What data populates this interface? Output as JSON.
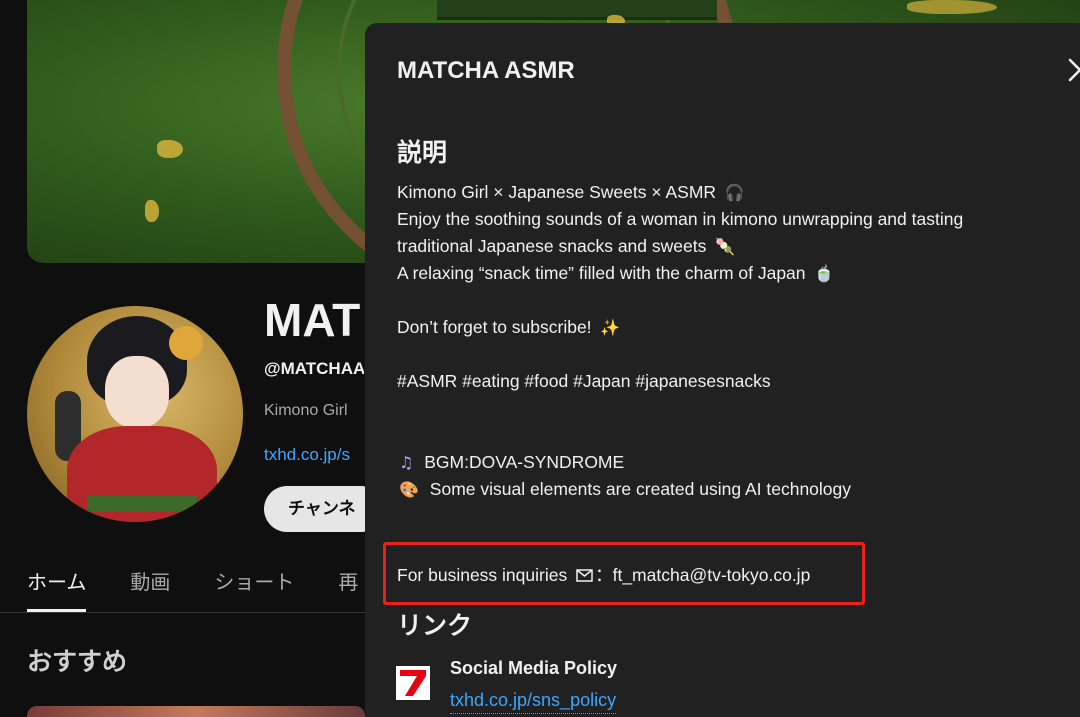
{
  "channel": {
    "name": "MAT",
    "handle": "@MATCHAA",
    "description_snippet": "Kimono Girl",
    "link": "txhd.co.jp/s",
    "subscribe_button": "チャンネ"
  },
  "tabs": [
    {
      "label": "ホーム",
      "active": true
    },
    {
      "label": "動画",
      "active": false
    },
    {
      "label": "ショート",
      "active": false
    },
    {
      "label": "再",
      "active": false
    }
  ],
  "section": {
    "title": "おすすめ"
  },
  "dialog": {
    "title": "MATCHA ASMR",
    "description_heading": "説明",
    "description_lines": [
      "Kimono Girl × Japanese Sweets × ASMR",
      "Enjoy the soothing sounds of a woman in kimono unwrapping and tasting",
      "traditional Japanese snacks and sweets",
      "A relaxing “snack time” filled with the charm of Japan",
      "Don’t forget to subscribe!",
      "#ASMR #eating #food #Japan #japanesesnacks",
      "BGM:DOVA-SYNDROME",
      "Some visual elements are created using AI technology"
    ],
    "emojis": {
      "headphones": "🎧",
      "dango": "🍡",
      "tea": "🍵",
      "sparkles": "✨",
      "music": "♫",
      "palette": "🎨"
    },
    "business": {
      "label": "For business inquiries",
      "separator": "：",
      "email": "ft_matcha@tv-tokyo.co.jp"
    },
    "links_heading": "リンク",
    "links": [
      {
        "title": "Social Media Policy",
        "url": "txhd.co.jp/sns_policy"
      }
    ]
  },
  "colors": {
    "background": "#0f0f0f",
    "dialog": "#212121",
    "link": "#3ea6ff",
    "highlight_box": "#e8201e",
    "logo_red": "#e60012"
  }
}
